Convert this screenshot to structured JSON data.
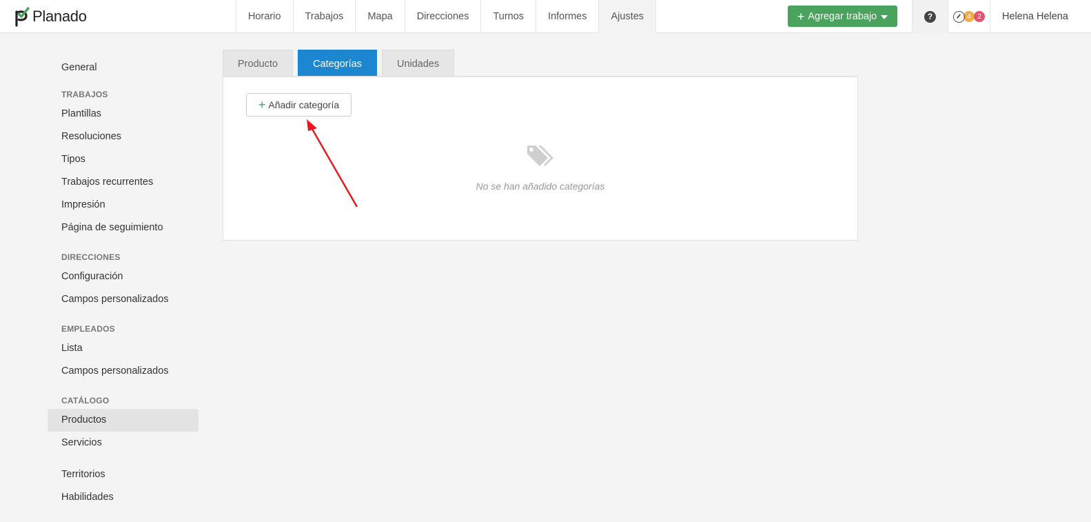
{
  "app": {
    "name": "Planado"
  },
  "nav": {
    "items": [
      {
        "label": "Horario"
      },
      {
        "label": "Trabajos"
      },
      {
        "label": "Mapa"
      },
      {
        "label": "Direcciones"
      },
      {
        "label": "Turnos"
      },
      {
        "label": "Informes"
      },
      {
        "label": "Ajustes",
        "active": true
      }
    ]
  },
  "header": {
    "add_job_label": "Agregar trabajo",
    "help_symbol": "?",
    "badges": {
      "orange": "4",
      "red": "2"
    },
    "user_name": "Helena Helena"
  },
  "sidebar": {
    "general": "General",
    "sections": [
      {
        "heading": "TRABAJOS",
        "items": [
          "Plantillas",
          "Resoluciones",
          "Tipos",
          "Trabajos recurrentes",
          "Impresión",
          "Página de seguimiento"
        ]
      },
      {
        "heading": "DIRECCIONES",
        "items": [
          "Configuración",
          "Campos personalizados"
        ]
      },
      {
        "heading": "EMPLEADOS",
        "items": [
          "Lista",
          "Campos personalizados"
        ]
      },
      {
        "heading": "CATÁLOGO",
        "items": [
          "Productos",
          "Servicios"
        ]
      }
    ],
    "extra": [
      "Territorios",
      "Habilidades"
    ],
    "active_item": "Productos"
  },
  "tabs": [
    {
      "label": "Producto"
    },
    {
      "label": "Categorías",
      "active": true
    },
    {
      "label": "Unidades"
    }
  ],
  "content": {
    "add_button_label": "Añadir categoría",
    "empty_message": "No se han añadido categorías",
    "empty_icon": "tags-icon"
  },
  "colors": {
    "brand_green": "#4aa35c",
    "active_tab": "#1c86d1",
    "annotation_arrow": "#e8181f"
  }
}
